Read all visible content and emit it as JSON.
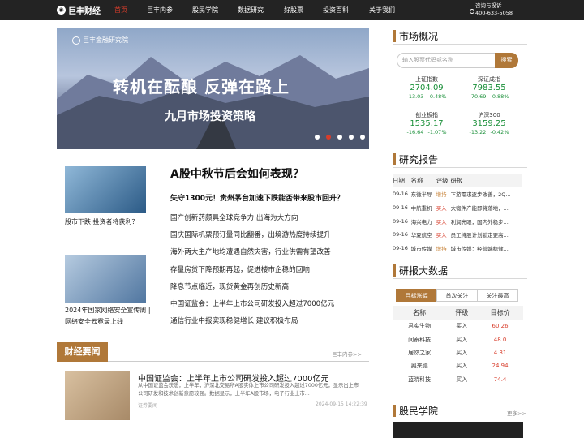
{
  "brand": {
    "name": "巨丰财经"
  },
  "nav": {
    "items": [
      "首页",
      "巨丰内参",
      "股民学院",
      "数据研究",
      "好股票",
      "投资百科",
      "关于我们"
    ]
  },
  "contact": {
    "label": "咨询与投诉",
    "phone": "400-633-5058"
  },
  "banner": {
    "org": "巨丰金融研究院",
    "title": "转机在酝酿 反弹在路上",
    "subtitle": "九月市场投资策略"
  },
  "left_articles": [
    {
      "caption": "股市下跌 投资者将获利？"
    },
    {
      "caption": "2024年国家网络安全宣传周 | 网络安全云霓录上线"
    }
  ],
  "feature": {
    "headline": "A股中秋节后会如何表现？",
    "subhead": "失守1300元！贵州茅台加速下跌能否带来股市回升？",
    "list": [
      "国产创新药颇具全球竞争力 出海为大方向",
      "国庆国际机票预订量同比翻番，出境游热度持续提升",
      "海外两大主产地均遭遇自然灾害，行业供需有望改善",
      "存量房贷下降预期再起，促进楼市企稳的回响",
      "降息节点临近，现货黄金再创历史新高",
      "中国证监会：上半年上市公司研发投入超过7000亿元",
      "通信行业中报实现稳健增长 建议积极布局"
    ]
  },
  "finance_news": {
    "tab": "财经要闻",
    "more": "巨丰内参>>",
    "title": "中国证监会：上半年上市公司研发投入超过7000亿元",
    "summary": "从中国证监会获悉，上半年，沪深北交易所A股实体上市公司研发投入超过7000亿元，显示出上市公司研发和技术创新意愿较强。数据显示，上半年A股市场，电子行业上市...",
    "source": "证券要闻",
    "time": "2024-09-15 14:22:39"
  },
  "market": {
    "title": "市场概况",
    "search_placeholder": "输入股票代码或名称",
    "search_button": "搜索",
    "indexes": [
      {
        "name": "上证指数",
        "value": "2704.09",
        "change": "-13.03 -0.48%"
      },
      {
        "name": "深证成指",
        "value": "7983.55",
        "change": "-70.69 -0.88%"
      },
      {
        "name": "创业板指",
        "value": "1535.17",
        "change": "-16.64 -1.07%"
      },
      {
        "name": "沪深300",
        "value": "3159.25",
        "change": "-13.22 -0.42%"
      }
    ]
  },
  "research": {
    "title": "研究报告",
    "headers": [
      "日期",
      "名称",
      "评级",
      "研报"
    ],
    "rows": [
      [
        "09-16",
        "东微半导",
        "增持",
        "下游需求逐步改善，2Q..."
      ],
      [
        "09-16",
        "中航重机",
        "买入",
        "大锻件产能即将落地，..."
      ],
      [
        "09-16",
        "海兴电力",
        "买入",
        "利润亮眼，国内外稳步..."
      ],
      [
        "09-16",
        "华夏航空",
        "买入",
        "员工持股计划锁定更高..."
      ],
      [
        "09-16",
        "城市传媒",
        "增持",
        "城市传媒：经营端稳健..."
      ]
    ]
  },
  "bigdata": {
    "title": "研报大数据",
    "tabs": [
      "目标涨幅",
      "首次关注",
      "关注最高"
    ],
    "headers": [
      "名称",
      "评级",
      "目标价"
    ],
    "rows": [
      [
        "君实生物",
        "买入",
        "60.26"
      ],
      [
        "闻泰科技",
        "买入",
        "48.0"
      ],
      [
        "居然之家",
        "买入",
        "4.31"
      ],
      [
        "奥来德",
        "买入",
        "24.94"
      ],
      [
        "蓝晓科技",
        "买入",
        "74.4"
      ]
    ]
  },
  "academy": {
    "title": "股民学院",
    "more": "更多>>"
  }
}
